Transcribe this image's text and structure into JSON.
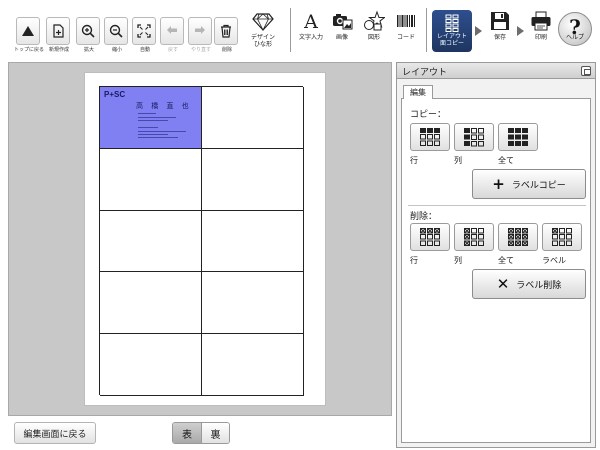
{
  "toolbar": {
    "left_buttons": [
      {
        "label": "トップに戻る",
        "icon": "triangle-up-icon",
        "enabled": true
      },
      {
        "label": "新規作成",
        "icon": "new-document-icon",
        "enabled": true
      },
      {
        "label": "拡大",
        "icon": "zoom-in-icon",
        "enabled": true
      },
      {
        "label": "縮小",
        "icon": "zoom-out-icon",
        "enabled": true
      },
      {
        "label": "自動",
        "icon": "fit-screen-icon",
        "enabled": true
      },
      {
        "label": "戻す",
        "icon": "undo-icon",
        "enabled": false
      },
      {
        "label": "やり直す",
        "icon": "redo-icon",
        "enabled": false
      },
      {
        "label": "削除",
        "icon": "trash-icon",
        "enabled": true
      }
    ],
    "design": {
      "label": "デザイン\nひな形",
      "icon": "diamond-icon"
    },
    "insert_tools": [
      {
        "label": "文字入力",
        "icon": "text-a-icon"
      },
      {
        "label": "画像",
        "icon": "camera-image-icon"
      },
      {
        "label": "図形",
        "icon": "shapes-icon"
      },
      {
        "label": "コード",
        "icon": "barcode-icon"
      }
    ],
    "layout_copy": {
      "label": "レイアウト\n面コピー",
      "icon": "layout-grid-icon",
      "active": true
    },
    "save": {
      "label": "保存",
      "icon": "floppy-disk-icon"
    },
    "print": {
      "label": "印刷",
      "icon": "printer-icon"
    },
    "help": {
      "label": "ヘルプ",
      "glyph": "?",
      "icon": "help-icon"
    }
  },
  "canvas": {
    "card": {
      "logo": "P+SC",
      "name": "高 橋 直 也"
    },
    "grid_rows": 5,
    "grid_cols": 2,
    "selected_cell": 0
  },
  "bottom": {
    "back_label": "編集画面に戻る",
    "front_label": "表",
    "back_side_label": "裏",
    "active_side": "front"
  },
  "panel": {
    "title": "レイアウト",
    "tab_label": "編集",
    "copy_section": {
      "label": "コピー：",
      "options": [
        "行",
        "列",
        "全て"
      ],
      "action_label": "ラベルコピー",
      "action_icon": "plus-icon"
    },
    "delete_section": {
      "label": "削除：",
      "options": [
        "行",
        "列",
        "全て",
        "ラベル"
      ],
      "action_label": "ラベル削除",
      "action_icon": "x-icon"
    }
  },
  "colors": {
    "selected_cell": "#8080f2",
    "active_tool": "#2e4f8e",
    "canvas_bg": "#c8c8c8"
  }
}
